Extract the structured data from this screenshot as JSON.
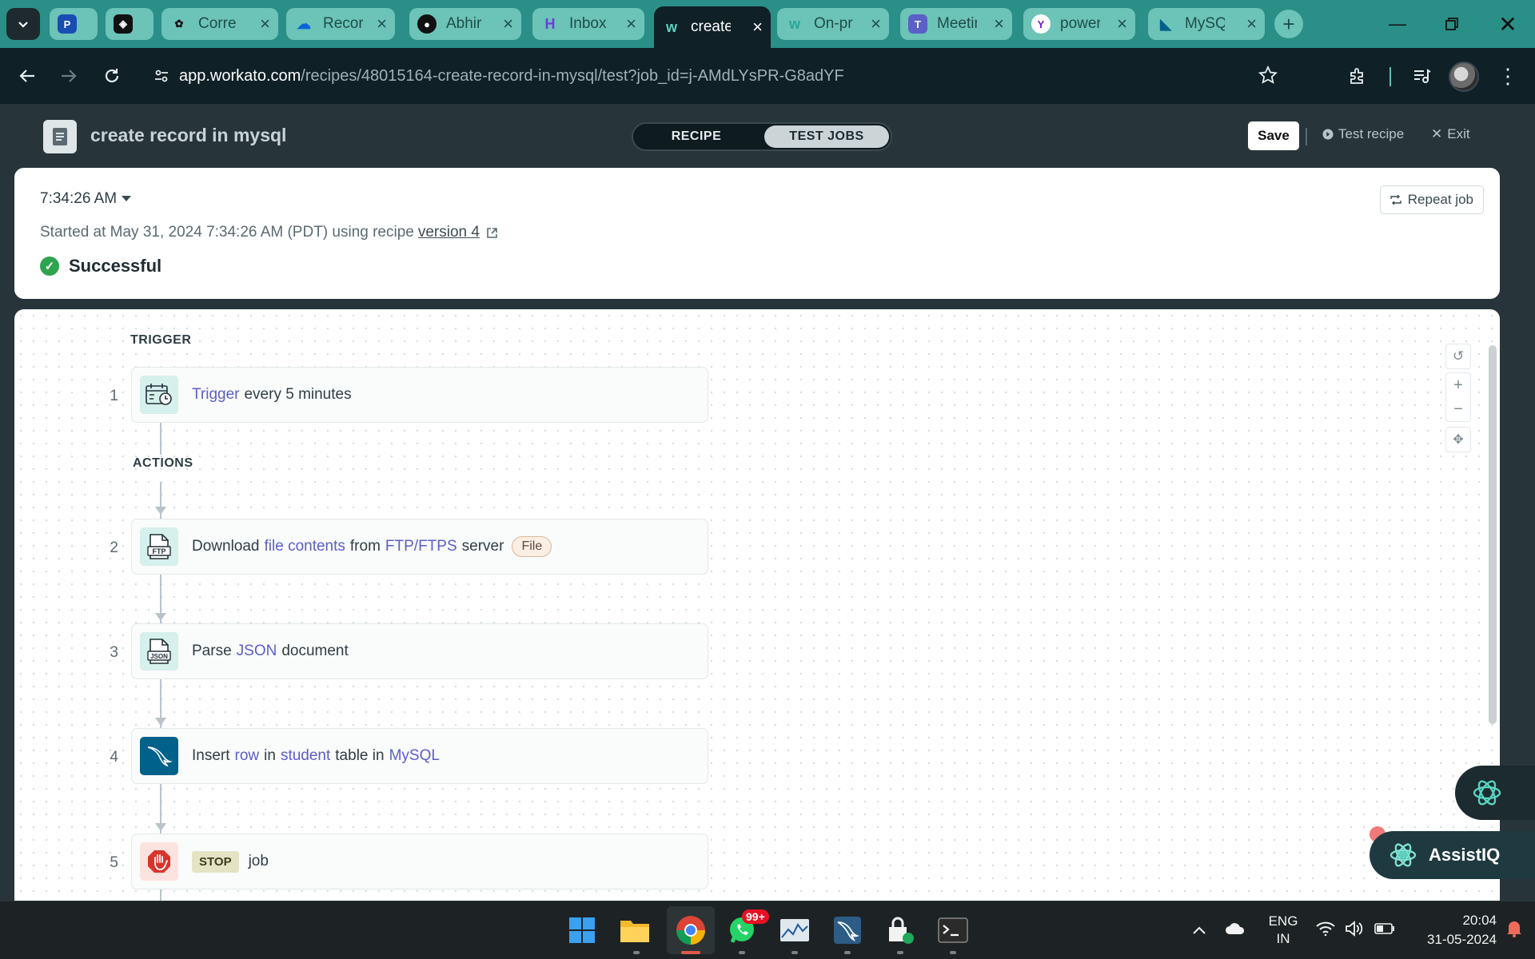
{
  "browser": {
    "tabs": [
      {
        "label": "",
        "icon": "ps-icon",
        "color": "#1a4db3"
      },
      {
        "label": "",
        "icon": "mask-icon",
        "color": "#222222"
      },
      {
        "label": "Corre",
        "icon": "openai-icon",
        "color": "#111111"
      },
      {
        "label": "Recor",
        "icon": "onedrive-icon",
        "color": "#0a64d8"
      },
      {
        "label": "Abhir",
        "icon": "github-icon",
        "color": "#111111"
      },
      {
        "label": "Inbox",
        "icon": "inbox-icon",
        "color": "#6b3fd6"
      },
      {
        "label": "create",
        "icon": "workato-icon",
        "color": "#59d2c0"
      },
      {
        "label": "On-pr",
        "icon": "workato-icon",
        "color": "#2aa59a"
      },
      {
        "label": "Meetir",
        "icon": "teams-icon",
        "color": "#5b5fc7"
      },
      {
        "label": "power",
        "icon": "yahoo-icon",
        "color": "#6b1fd6"
      },
      {
        "label": "MySQ",
        "icon": "mysql-icon",
        "color": "#00618a"
      }
    ],
    "url_host": "app.workato.com",
    "url_path": "/recipes/48015164-create-record-in-mysql/test?job_id=j-AMdLYsPR-G8adYF"
  },
  "header": {
    "recipe_title": "create record in mysql",
    "tab_recipe": "RECIPE",
    "tab_test_jobs": "TEST JOBS",
    "save_label": "Save",
    "test_recipe_label": "Test recipe",
    "exit_label": "Exit"
  },
  "job": {
    "time": "7:34:26 AM",
    "started_prefix": "Started at May 31, 2024 7:34:26 AM (PDT) using recipe",
    "version_link": "version 4",
    "status": "Successful",
    "repeat_label": "Repeat job"
  },
  "canvas": {
    "trigger_section": "TRIGGER",
    "actions_section": "ACTIONS",
    "steps": [
      {
        "num": "1",
        "parts": [
          {
            "t": "Trigger",
            "kw": true
          },
          {
            "t": "every 5 minutes"
          }
        ]
      },
      {
        "num": "2",
        "parts": [
          {
            "t": "Download"
          },
          {
            "t": "file contents",
            "kw": true
          },
          {
            "t": "from"
          },
          {
            "t": "FTP/FTPS",
            "kw": true
          },
          {
            "t": "server"
          }
        ],
        "pill": "File"
      },
      {
        "num": "3",
        "parts": [
          {
            "t": "Parse"
          },
          {
            "t": "JSON",
            "kw": true
          },
          {
            "t": "document"
          }
        ]
      },
      {
        "num": "4",
        "parts": [
          {
            "t": "Insert"
          },
          {
            "t": "row",
            "kw": true
          },
          {
            "t": "in"
          },
          {
            "t": "student",
            "kw": true
          },
          {
            "t": "table in"
          },
          {
            "t": "MySQL",
            "kw": true
          }
        ]
      },
      {
        "num": "5",
        "stop": "STOP",
        "parts": [
          {
            "t": "job"
          }
        ]
      }
    ],
    "icon_ftp": "FTP",
    "icon_json": "JSON"
  },
  "assist": {
    "label": "AssistIQ"
  },
  "taskbar": {
    "whatsapp_badge": "99+",
    "lang_top": "ENG",
    "lang_bottom": "IN",
    "clock_time": "20:04",
    "clock_date": "31-05-2024"
  },
  "colors": {
    "keyword": "#5b5fc7",
    "success": "#2ea44f",
    "teal_chrome": "#2a8f86"
  }
}
